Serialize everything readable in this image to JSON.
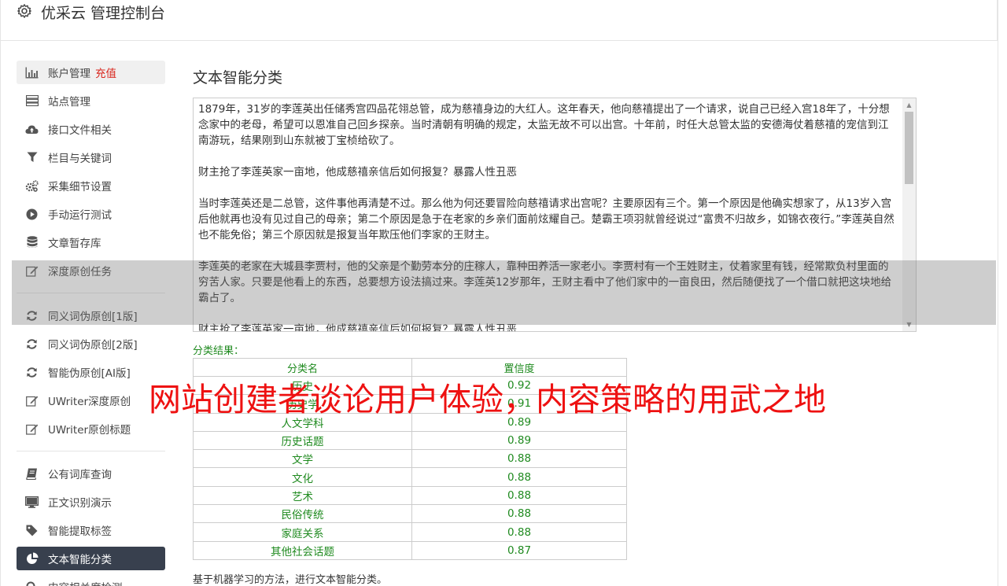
{
  "header": {
    "title": "优采云 管理控制台",
    "icon": "gear-icon"
  },
  "sidebar": {
    "items": [
      {
        "label": "账户管理",
        "extra": "充值",
        "icon": "bar-chart-icon"
      },
      {
        "label": "站点管理",
        "icon": "server-icon"
      },
      {
        "label": "接口文件相关",
        "icon": "cloud-upload-icon"
      },
      {
        "label": "栏目与关键词",
        "icon": "filter-icon"
      },
      {
        "label": "采集细节设置",
        "icon": "cogs-icon"
      },
      {
        "label": "手动运行测试",
        "icon": "play-circle-icon"
      },
      {
        "label": "文章暂存库",
        "icon": "database-icon"
      },
      {
        "label": "深度原创任务",
        "icon": "edit-icon"
      },
      {
        "label": "同义词伪原创[1版]",
        "icon": "refresh-icon"
      },
      {
        "label": "同义词伪原创[2版]",
        "icon": "refresh-icon"
      },
      {
        "label": "智能伪原创[AI版]",
        "icon": "refresh-icon"
      },
      {
        "label": "UWriter深度原创",
        "icon": "edit-icon"
      },
      {
        "label": "UWriter原创标题",
        "icon": "edit-icon"
      },
      {
        "label": "公有词库查询",
        "icon": "book-icon"
      },
      {
        "label": "正文识别演示",
        "icon": "monitor-icon"
      },
      {
        "label": "智能提取标签",
        "icon": "tag-icon"
      },
      {
        "label": "文本智能分类",
        "icon": "pie-chart-icon"
      },
      {
        "label": "内容相关度检测",
        "icon": "search-icon"
      }
    ]
  },
  "main": {
    "title": "文本智能分类",
    "paragraphs": [
      "1879年，31岁的李莲英出任储秀宫四品花翎总管，成为慈禧身边的大红人。这年春天，他向慈禧提出了一个请求，说自己已经入宫18年了，十分想念家中的老母，希望可以恩准自己回乡探亲。当时清朝有明确的规定，太监无故不可以出宫。十年前，时任大总管太监的安德海仗着慈禧的宠信到江南游玩，结果刚到山东就被丁宝桢给砍了。",
      "财主抢了李莲英家一亩地，他成慈禧亲信后如何报复？暴露人性丑恶",
      "当时李莲英还是二总管，这件事他再清楚不过。那么他为何还要冒险向慈禧请求出宫呢？主要原因有三个。第一个原因是他确实想家了，从13岁入宫后他就再也没有见过自己的母亲；第二个原因是急于在老家的乡亲们面前炫耀自己。楚霸王项羽就曾经说过“富贵不归故乡，如锦衣夜行。”李莲英自然也不能免俗；第三个原因就是报复当年欺压他们李家的王财主。",
      "李莲英的老家在大城县李贾村，他的父亲是个勤劳本分的庄稼人，靠种田养活一家老小。李贾村有一个王姓财主，仗着家里有钱，经常欺负村里面的穷苦人家。只要是他看上的东西，总要想方设法搞过来。李莲英12岁那年，王财主看中了他们家中的一亩良田，然后随便找了一个借口就把这块地给霸占了。",
      "财主抢了李莲英家一亩地，他成慈禧亲信后如何报复？暴露人性丑恶"
    ],
    "result_label": "分类结果：",
    "table": {
      "headers": [
        "分类名",
        "置信度"
      ],
      "rows": [
        [
          "历史",
          "0.92"
        ],
        [
          "历史学",
          "0.91"
        ],
        [
          "人文学科",
          "0.89"
        ],
        [
          "历史话题",
          "0.89"
        ],
        [
          "文学",
          "0.88"
        ],
        [
          "文化",
          "0.88"
        ],
        [
          "艺术",
          "0.88"
        ],
        [
          "民俗传统",
          "0.88"
        ],
        [
          "家庭关系",
          "0.88"
        ],
        [
          "其他社会话题",
          "0.87"
        ]
      ]
    },
    "note": "基于机器学习的方法，进行文本智能分类。"
  },
  "watermark": "网站创建者谈论用户体验，内容策略的用武之地",
  "colors": {
    "active_bg": "#38404e",
    "result_green": "#1f8a1f",
    "recharge_red": "#d9241b",
    "watermark_red": "#ee1111"
  }
}
